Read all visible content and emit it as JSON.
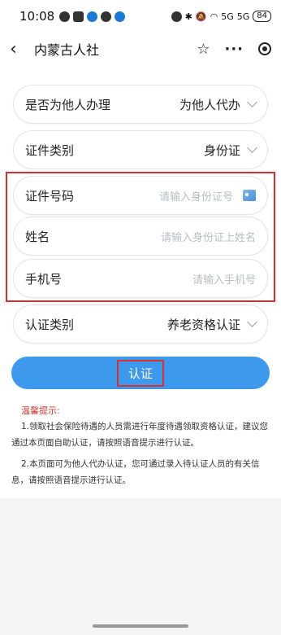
{
  "status_bar": {
    "time": "10:08",
    "battery": "84",
    "signal1": "5G",
    "signal2": "5G"
  },
  "nav": {
    "title": "内蒙古人社"
  },
  "form": {
    "agent": {
      "label": "是否为他人办理",
      "value": "为他人代办"
    },
    "id_type": {
      "label": "证件类别",
      "value": "身份证"
    },
    "id_number": {
      "label": "证件号码",
      "placeholder": "请输入身份证号"
    },
    "name": {
      "label": "姓名",
      "placeholder": "请输入身份证上姓名"
    },
    "phone": {
      "label": "手机号",
      "placeholder": "请输入手机号"
    },
    "auth_type": {
      "label": "认证类别",
      "value": "养老资格认证"
    }
  },
  "submit": {
    "label": "认证"
  },
  "tips": {
    "title": "温馨提示:",
    "items": [
      "1.领取社会保险待遇的人员需进行年度待遇领取资格认证，建议您通过本页面自助认证，请按照语音提示进行认证。",
      "2.本页面可为他人代办认证，您可通过录入待认证人员的有关信息，请按照语音提示进行认证。"
    ]
  },
  "colors": {
    "accent": "#3d99ec",
    "highlight": "#d9302f",
    "tips_title": "#d23a2f"
  }
}
